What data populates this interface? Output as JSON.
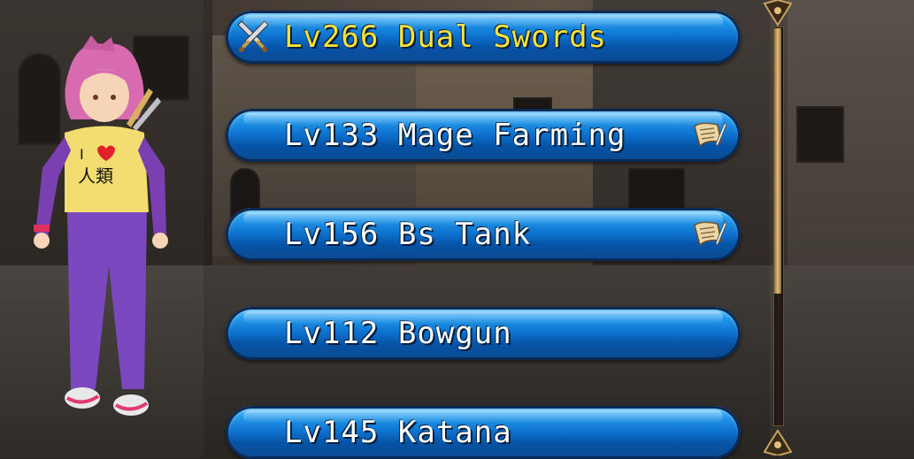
{
  "jobs": [
    {
      "level": "Lv266",
      "name": "Dual Swords",
      "selected": true,
      "icon": "dual-swords-icon",
      "scroll": false
    },
    {
      "level": "Lv133",
      "name": "Mage Farming",
      "selected": false,
      "icon": null,
      "scroll": true
    },
    {
      "level": "Lv156",
      "name": "Bs Tank",
      "selected": false,
      "icon": null,
      "scroll": true
    },
    {
      "level": "Lv112",
      "name": "Bowgun",
      "selected": false,
      "icon": null,
      "scroll": false
    },
    {
      "level": "Lv145",
      "name": "Katana",
      "selected": false,
      "icon": null,
      "scroll": false
    }
  ],
  "character": {
    "shirt_text": "I ♥ 人類",
    "hair_color": "#d86bb0"
  },
  "colors": {
    "selected_text": "#f7e23a",
    "text": "#ffffff",
    "button_blue": "#0d72cf"
  }
}
